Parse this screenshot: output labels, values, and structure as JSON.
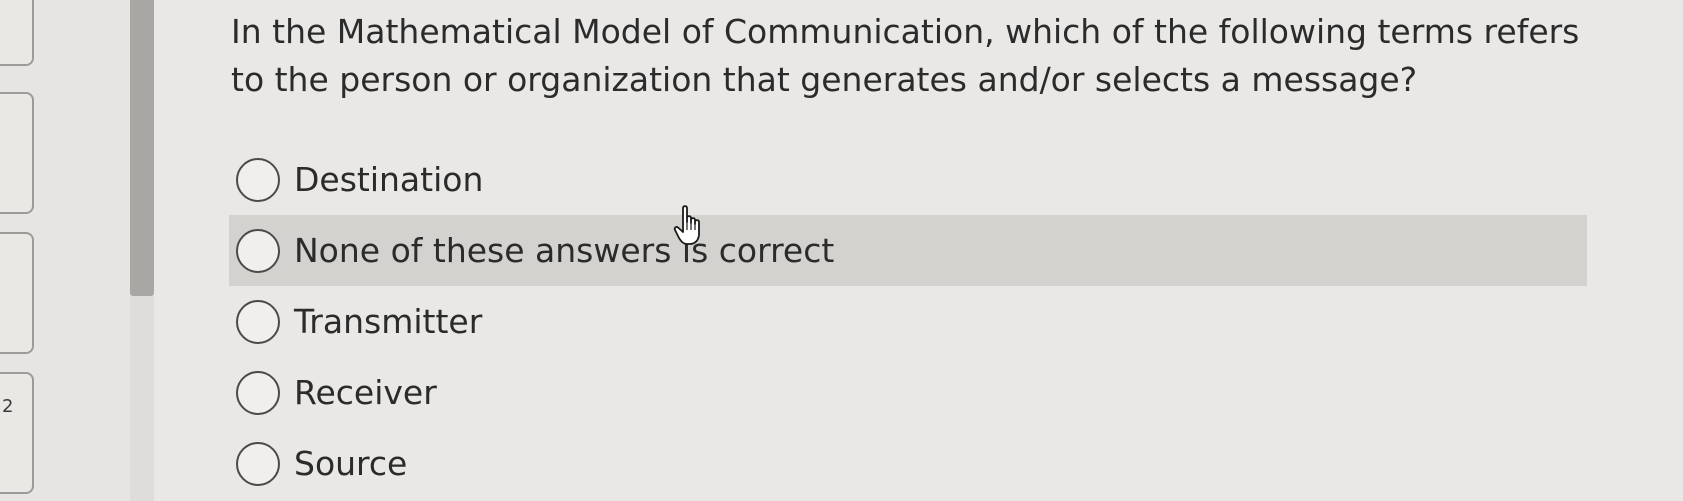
{
  "question": {
    "text": "In the Mathematical Model of Communication, which of the following terms refers to the person or organization that generates and/or selects a message?"
  },
  "options": [
    {
      "label": "Destination",
      "selected": false,
      "hovered": false
    },
    {
      "label": "None of these answers is correct",
      "selected": false,
      "hovered": true
    },
    {
      "label": "Transmitter",
      "selected": false,
      "hovered": false
    },
    {
      "label": "Receiver",
      "selected": false,
      "hovered": false
    },
    {
      "label": "Source",
      "selected": false,
      "hovered": false
    }
  ],
  "left_nav": {
    "marks": [
      "2"
    ]
  },
  "colors": {
    "background": "#e9e8e6",
    "hover_row": "#d3d2cf",
    "text": "#2b2b2b"
  },
  "icons": {
    "cursor": "hand-pointer-icon"
  }
}
